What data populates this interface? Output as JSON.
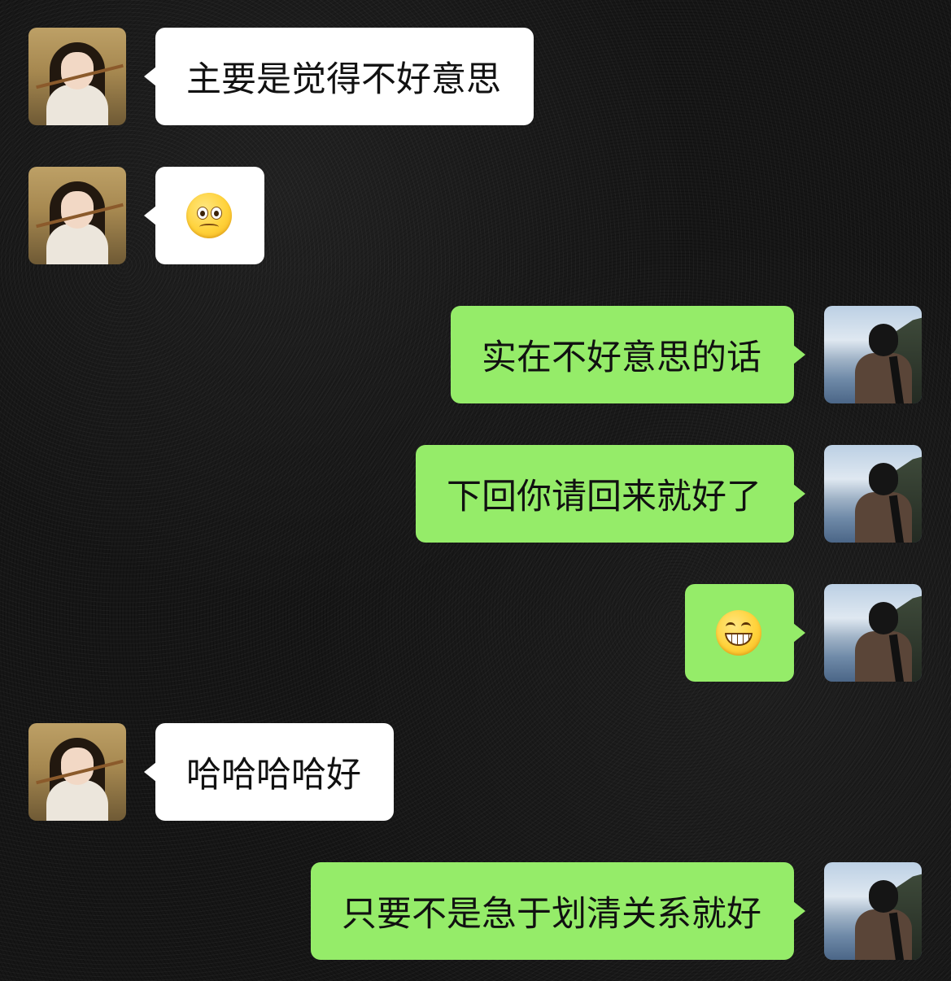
{
  "conversation": {
    "messages": [
      {
        "side": "left",
        "text": "主要是觉得不好意思"
      },
      {
        "side": "left",
        "emoji": "woozy-pleading-face-emoji"
      },
      {
        "side": "right",
        "text": "实在不好意思的话"
      },
      {
        "side": "right",
        "text": "下回你请回来就好了"
      },
      {
        "side": "right",
        "emoji": "grinning-face-emoji"
      },
      {
        "side": "left",
        "text": "哈哈哈哈好"
      },
      {
        "side": "right",
        "text": "只要不是急于划清关系就好"
      }
    ]
  },
  "colors": {
    "background": "#161616",
    "incoming_bubble": "#ffffff",
    "outgoing_bubble": "#95ec69",
    "text": "#111111"
  },
  "icons": {
    "incoming_avatar": "avatar-girl-photo",
    "outgoing_avatar": "avatar-man-landscape-photo"
  }
}
